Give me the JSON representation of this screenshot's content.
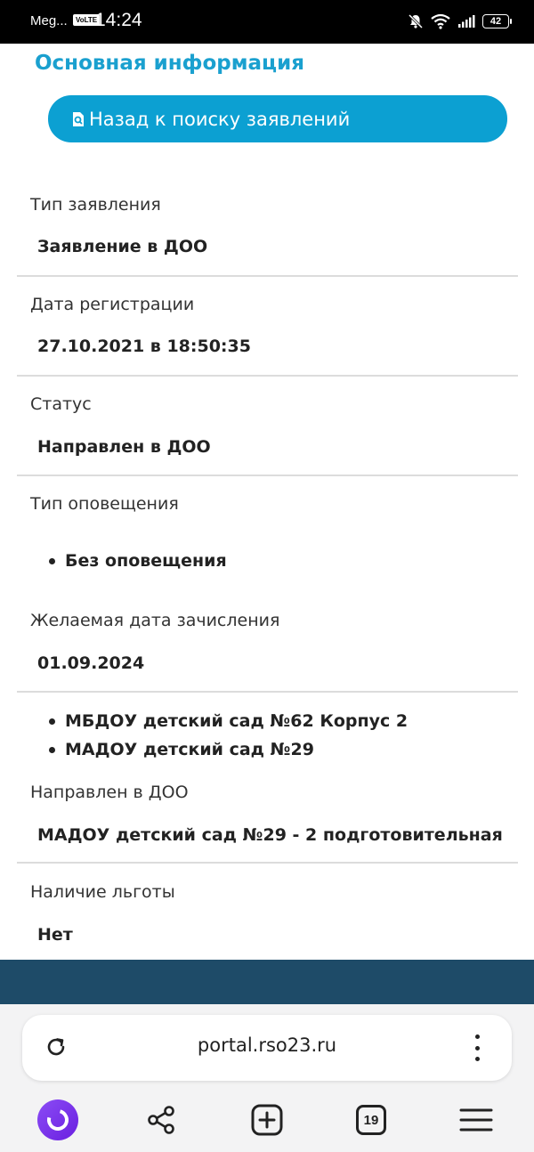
{
  "status_bar": {
    "carrier": "Meg...",
    "volte": "VoLTE",
    "time": "14:24",
    "battery": "42",
    "icons": [
      "bell-muted-icon",
      "wifi-icon",
      "signal-icon",
      "battery-icon"
    ]
  },
  "page": {
    "heading": "Основная информация",
    "back_button_label": "Назад к поиску заявлений"
  },
  "fields": {
    "app_type": {
      "label": "Тип заявления",
      "value": "Заявление в ДОО"
    },
    "reg_date": {
      "label": "Дата регистрации",
      "value": "27.10.2021 в 18:50:35"
    },
    "status": {
      "label": "Статус",
      "value": "Направлен в ДОО"
    },
    "notify_type": {
      "label": "Тип оповещения",
      "items": [
        "Без оповещения"
      ]
    },
    "desired_date": {
      "label": "Желаемая дата зачисления",
      "value": "01.09.2024"
    },
    "preferred_doo": {
      "items": [
        "МБДОУ детский сад №62 Корпус 2",
        "МАДОУ детский сад №29"
      ]
    },
    "assigned_doo": {
      "label": "Направлен в ДОО",
      "value": "МАДОУ детский сад №29 - 2 подготовительная"
    },
    "benefit": {
      "label": "Наличие льготы",
      "value": "Нет"
    }
  },
  "browser": {
    "url": "portal.rso23.ru",
    "tabs_count": "19",
    "accent_color": "#0ca0d2",
    "footer_color": "#1e4b68"
  }
}
